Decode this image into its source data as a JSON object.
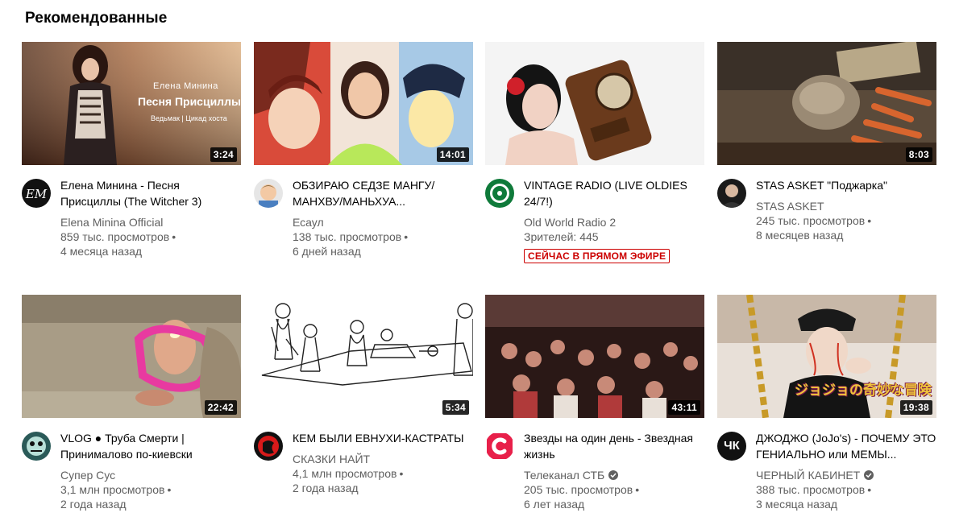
{
  "shelf": {
    "title": "Рекомендованные"
  },
  "videos": [
    {
      "title": "Елена Минина - Песня Присциллы (The Witcher 3)",
      "channel": "Elena Minina Official",
      "views": "859 тыс. просмотров",
      "age": "4 месяца назад",
      "duration": "3:24",
      "thumb_text": [
        "Елена Минина",
        "Песня Присциллы",
        "Ведьмак | Цикад хоста"
      ]
    },
    {
      "title": "ОБЗИРАЮ СЕДЗЕ МАНГУ/МАНХВУ/МАНЬХУА...",
      "channel": "Есаул",
      "views": "138 тыс. просмотров",
      "age": "6 дней назад",
      "duration": "14:01"
    },
    {
      "title": "VINTAGE RADIO (LIVE OLDIES 24/7!)",
      "channel": "Old World Radio 2",
      "viewers": "Зрителей: 445",
      "live": "СЕЙЧАС В ПРЯМОМ ЭФИРЕ"
    },
    {
      "title": "STAS ASKET \"Поджарка\"",
      "channel": "STAS ASKET",
      "views": "245 тыс. просмотров",
      "age": "8 месяцев назад",
      "duration": "8:03"
    },
    {
      "title": "VLOG ● Труба Смерти | Принималово по-киевски",
      "channel": "Супер Сус",
      "views": "3,1 млн просмотров",
      "age": "2 года назад",
      "duration": "22:42"
    },
    {
      "title": "КЕМ БЫЛИ ЕВНУХИ-КАСТРАТЫ",
      "channel": "СКАЗКИ НАЙТ",
      "views": "4,1 млн просмотров",
      "age": "2 года назад",
      "duration": "5:34"
    },
    {
      "title": "Звезды на один день - Звездная жизнь",
      "channel": "Телеканал СТБ",
      "views": "205 тыс. просмотров",
      "age": "6 лет назад",
      "duration": "43:11",
      "verified": true
    },
    {
      "title": "ДЖОДЖО (JoJo's) - ПОЧЕМУ ЭТО ГЕНИАЛЬНО или МЕМЫ...",
      "channel": "ЧЕРНЫЙ КАБИНЕТ",
      "views": "388 тыс. просмотров",
      "age": "3 месяца назад",
      "duration": "19:38",
      "verified": true,
      "avatar_text": "ЧК",
      "thumb_text": "ジョジョの奇妙な冒険"
    }
  ],
  "colors": {
    "live_red": "#cc0000",
    "meta_gray": "#606060",
    "stb_red": "#e8204a"
  }
}
